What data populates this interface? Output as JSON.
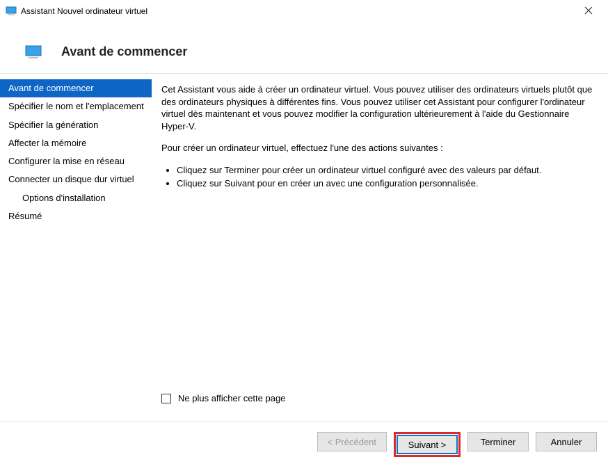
{
  "window": {
    "title": "Assistant Nouvel ordinateur virtuel"
  },
  "header": {
    "title": "Avant de commencer"
  },
  "sidebar": {
    "items": [
      {
        "label": "Avant de commencer",
        "selected": true
      },
      {
        "label": "Spécifier le nom et l'emplacement"
      },
      {
        "label": "Spécifier la génération"
      },
      {
        "label": "Affecter la mémoire"
      },
      {
        "label": "Configurer la mise en réseau"
      },
      {
        "label": "Connecter un disque dur virtuel"
      },
      {
        "label": "Options d'installation",
        "sub": true
      },
      {
        "label": "Résumé"
      }
    ]
  },
  "content": {
    "intro": "Cet Assistant vous aide à créer un ordinateur virtuel. Vous pouvez utiliser des ordinateurs virtuels plutôt que des ordinateurs physiques à différentes fins. Vous pouvez utiliser cet Assistant pour configurer l'ordinateur virtuel dès maintenant et vous pouvez modifier la configuration ultérieurement à l'aide du Gestionnaire Hyper-V.",
    "prompt": "Pour créer un ordinateur virtuel, effectuez l'une des actions suivantes :",
    "bullets": [
      "Cliquez sur Terminer pour créer un ordinateur virtuel configuré avec des valeurs par défaut.",
      "Cliquez sur Suivant pour en créer un avec une configuration personnalisée."
    ],
    "checkbox_label": "Ne plus afficher cette page"
  },
  "footer": {
    "previous": "< Précédent",
    "next": "Suivant >",
    "finish": "Terminer",
    "cancel": "Annuler"
  },
  "colors": {
    "selection": "#0d66c6",
    "emphasis_border": "#d92b2b",
    "default_button_border": "#1075c9"
  }
}
